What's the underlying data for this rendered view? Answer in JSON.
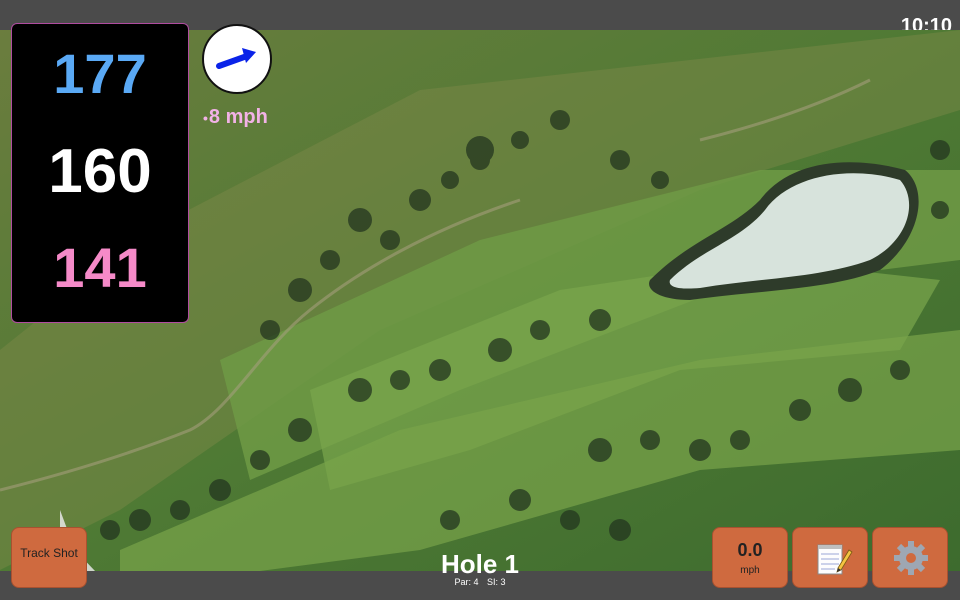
{
  "status_bar": {
    "time": "10:10"
  },
  "distances": {
    "back": "177",
    "middle": "160",
    "front": "141"
  },
  "wind": {
    "speed_label": "8 mph",
    "arrow_icon": "wind-arrow-icon"
  },
  "hole": {
    "title": "Hole 1",
    "par": "Par: 4",
    "si": "SI: 3"
  },
  "buttons": {
    "track_shot": "Track Shot",
    "wind_value": "0.0",
    "wind_unit": "mph",
    "notes_icon": "notepad-icon",
    "settings_icon": "gear-icon"
  },
  "colors": {
    "back_distance": "#5aa9f5",
    "middle_distance": "#ffffff",
    "front_distance": "#f58ac8",
    "button": "#cf6a3f",
    "wind_arrow": "#0a23e8"
  }
}
